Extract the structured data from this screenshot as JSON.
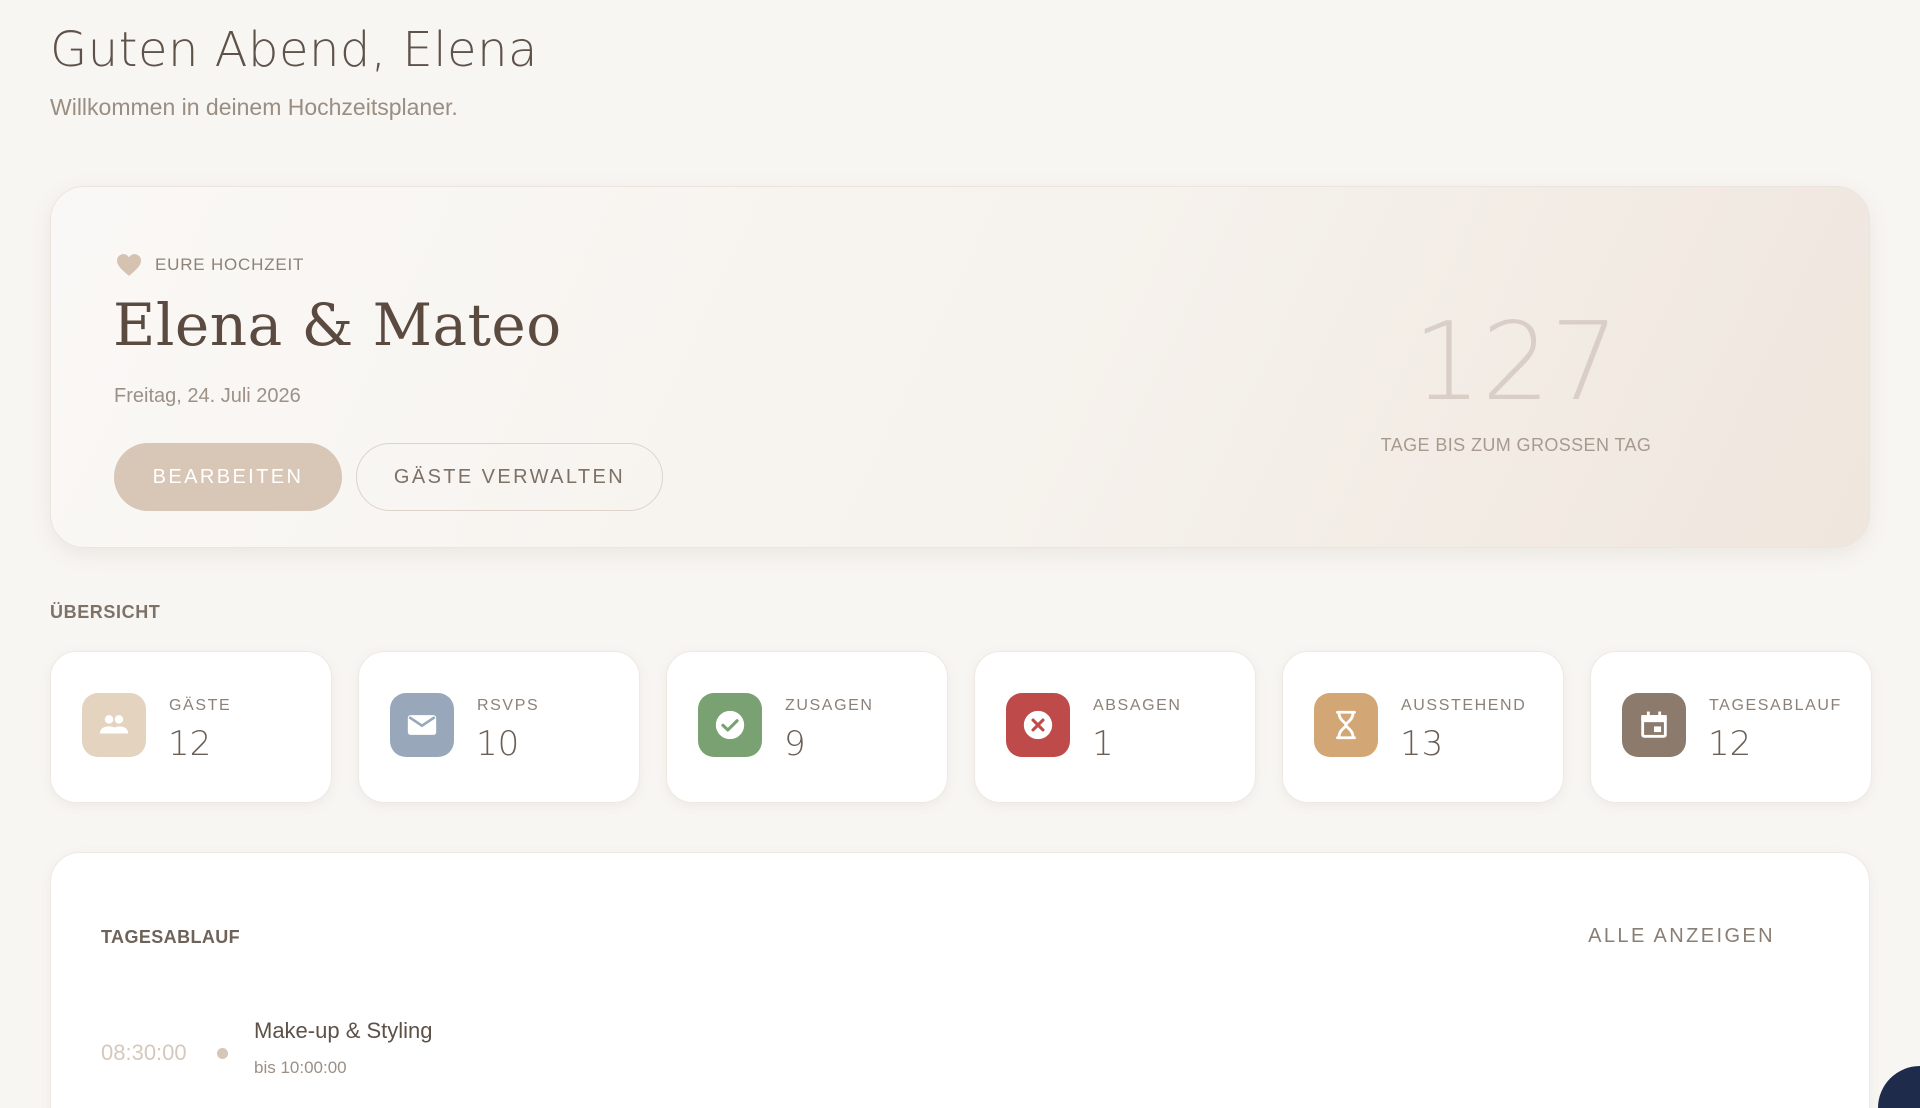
{
  "header": {
    "greeting": "Guten Abend, Elena",
    "subtitle": "Willkommen in deinem Hochzeitsplaner."
  },
  "hero": {
    "label": "EURE HOCHZEIT",
    "couple": "Elena & Mateo",
    "date": "Freitag, 24. Juli 2026",
    "edit_button": "BEARBEITEN",
    "guests_button": "GÄSTE VERWALTEN",
    "countdown_value": "127",
    "countdown_label": "TAGE BIS ZUM GROSSEN TAG",
    "icon": "heart-icon"
  },
  "overview": {
    "title": "ÜBERSICHT",
    "stats": [
      {
        "label": "GÄSTE",
        "value": "12",
        "icon": "people-icon",
        "color": "#e3d3bf"
      },
      {
        "label": "RSVPS",
        "value": "10",
        "icon": "mail-icon",
        "color": "#98a8ba"
      },
      {
        "label": "ZUSAGEN",
        "value": "9",
        "icon": "check-circle-icon",
        "color": "#7aa171"
      },
      {
        "label": "ABSAGEN",
        "value": "1",
        "icon": "cancel-circle-icon",
        "color": "#bf4a4a"
      },
      {
        "label": "AUSSTEHEND",
        "value": "13",
        "icon": "hourglass-icon",
        "color": "#d3a676"
      },
      {
        "label": "TAGESABLAUF",
        "value": "12",
        "icon": "calendar-icon",
        "color": "#8c7b6c"
      }
    ]
  },
  "timeline": {
    "title": "TAGESABLAUF",
    "show_all": "ALLE ANZEIGEN",
    "items": [
      {
        "time": "08:30:00",
        "name": "Make-up & Styling",
        "until": "bis 10:00:00"
      }
    ]
  }
}
